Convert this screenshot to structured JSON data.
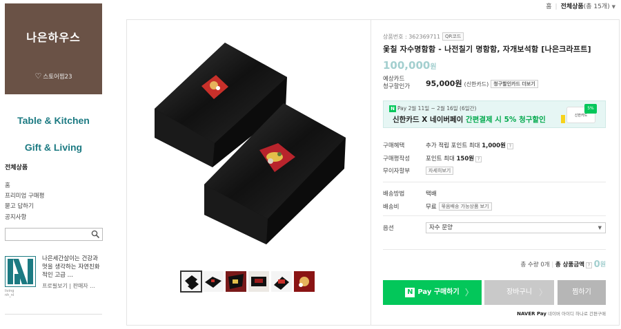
{
  "breadcrumb": {
    "home": "홈",
    "current": "전체상품",
    "count_text": "(총 15개)"
  },
  "store": {
    "name": "나은하우스",
    "fav_label": "스토어찜23"
  },
  "sidebar": {
    "categories": [
      "Table & Kitchen",
      "Gift & Living"
    ],
    "all_products": "전체상품",
    "links": [
      "홈",
      "프리미엄 구매평",
      "묻고 답하기",
      "공지사항"
    ],
    "brand_desc": "나은세간살이는 건강과 멋을 생각하는 자연친화적인 고급 ...",
    "brand_links": "프로필보기 | 판매자 ...",
    "brand_sub": "living\nnh_nl"
  },
  "product": {
    "pid_label": "상품번호 : 362369711",
    "qr_label": "QR코드",
    "title": "옻칠 자수명함함 - 나전칠기 명함함, 자개보석함 [나은크라프트]",
    "price": "100,000",
    "price_unit": "원",
    "card_label_1": "예상카드",
    "card_label_2": "청구할인가",
    "card_price": "95,000원",
    "card_name": "(신한카드)",
    "card_more": "청구할인카드 더보기"
  },
  "banner": {
    "npay": "Pay",
    "period": "2월 11일 ~ 2월 16일 (6일간)",
    "main_prefix": "신한카드 X 네이버페이 ",
    "main_highlight": "간편결제 시 5% 청구할인",
    "card_text": "신한카드",
    "badge": "5%"
  },
  "rows": {
    "benefit_label": "구매혜택",
    "benefit_value_prefix": "추가 적립 포인트 최대 ",
    "benefit_value_amount": "1,000원",
    "review_label": "구매평작성",
    "review_value_prefix": "포인트 최대 ",
    "review_value_amount": "150원",
    "installment_label": "무이자할부",
    "installment_btn": "자세히보기",
    "shipping_label": "배송방법",
    "shipping_value": "택배",
    "fee_label": "배송비",
    "fee_value": "무료",
    "fee_btn": "묶음배송 가능상품 보기",
    "option_label": "옵션",
    "option_value": "자수 문양"
  },
  "totals": {
    "qty_text": "총 수량 0개",
    "sep": "|",
    "amount_label": "총 상품금액",
    "amount": "0",
    "unit": "원"
  },
  "buttons": {
    "buy": "Pay 구매하기",
    "cart": "장바구니",
    "wish": "찜하기"
  },
  "npay_note": {
    "brand": "NAVER Pay",
    "text": "네이버 아이디 하나로 간편구매"
  },
  "colors": {
    "brand_brown": "#6a5246",
    "teal": "#1c7a82",
    "npay_green": "#03c75a",
    "price": "#a3cfcf"
  }
}
